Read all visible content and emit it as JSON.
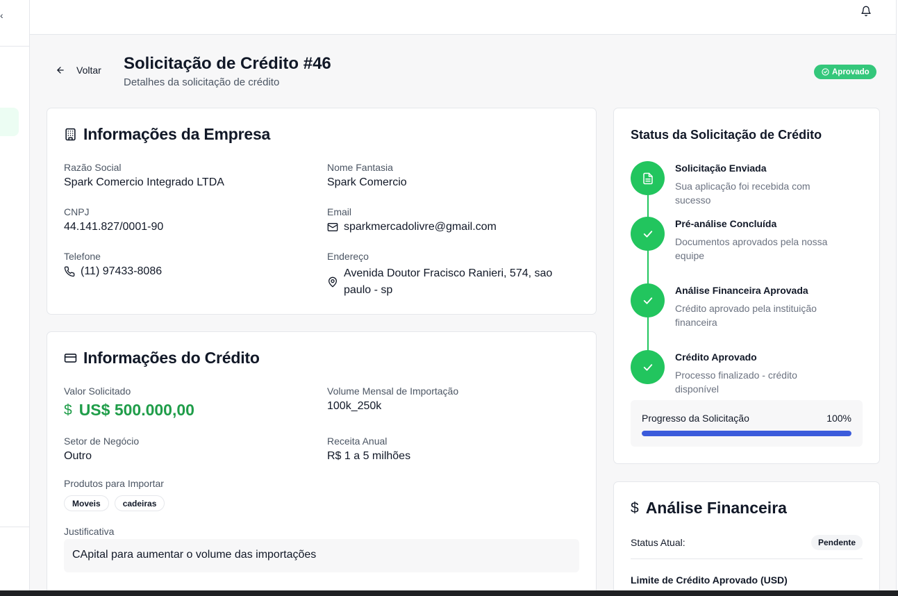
{
  "header": {
    "collapse_glyph": "‹"
  },
  "page": {
    "back_label": "Voltar",
    "title": "Solicitação de Crédito #46",
    "subtitle": "Detalhes da solicitação de crédito",
    "status_label": "Aprovado"
  },
  "company": {
    "title": "Informações da Empresa",
    "razao_label": "Razão Social",
    "razao_value": "Spark Comercio Integrado LTDA",
    "fantasia_label": "Nome Fantasia",
    "fantasia_value": "Spark Comercio",
    "cnpj_label": "CNPJ",
    "cnpj_value": "44.141.827/0001-90",
    "email_label": "Email",
    "email_value": "sparkmercadolivre@gmail.com",
    "telefone_label": "Telefone",
    "telefone_value": "(11) 97433-8086",
    "endereco_label": "Endereço",
    "endereco_value": "Avenida Doutor Fracisco Ranieri, 574, sao paulo - sp"
  },
  "credit": {
    "title": "Informações do Crédito",
    "valor_label": "Valor Solicitado",
    "valor_currency_symbol": "$",
    "valor_value": "US$ 500.000,00",
    "volume_label": "Volume Mensal de Importação",
    "volume_value": "100k_250k",
    "setor_label": "Setor de Negócio",
    "setor_value": "Outro",
    "receita_label": "Receita Anual",
    "receita_value": "R$ 1 a 5 milhões",
    "produtos_label": "Produtos para Importar",
    "produtos": [
      "Moveis",
      "cadeiras"
    ],
    "justificativa_label": "Justificativa",
    "justificativa_value": "CApital para aumentar o volume das importações"
  },
  "status_card": {
    "title": "Status da Solicitação de Crédito",
    "steps": [
      {
        "title": "Solicitação Enviada",
        "desc": "Sua aplicação foi recebida com sucesso",
        "icon": "document-icon"
      },
      {
        "title": "Pré-análise Concluída",
        "desc": "Documentos aprovados pela nossa equipe",
        "icon": "check-icon"
      },
      {
        "title": "Análise Financeira Aprovada",
        "desc": "Crédito aprovado pela instituição financeira",
        "icon": "check-icon"
      },
      {
        "title": "Crédito Aprovado",
        "desc": "Processo finalizado - crédito disponível",
        "icon": "check-icon"
      }
    ],
    "progress_label": "Progresso da Solicitação",
    "progress_text": "100%",
    "progress_fraction": 1.0
  },
  "financial": {
    "title": "Análise Financeira",
    "currency_symbol": "$",
    "status_label": "Status Atual:",
    "status_value": "Pendente",
    "limit_label": "Limite de Crédito Aprovado (USD)"
  },
  "colors": {
    "success": "#22c55e",
    "status_pill": "#34c77b",
    "amount": "#1f9d49",
    "progress": "#3b5bdb"
  }
}
